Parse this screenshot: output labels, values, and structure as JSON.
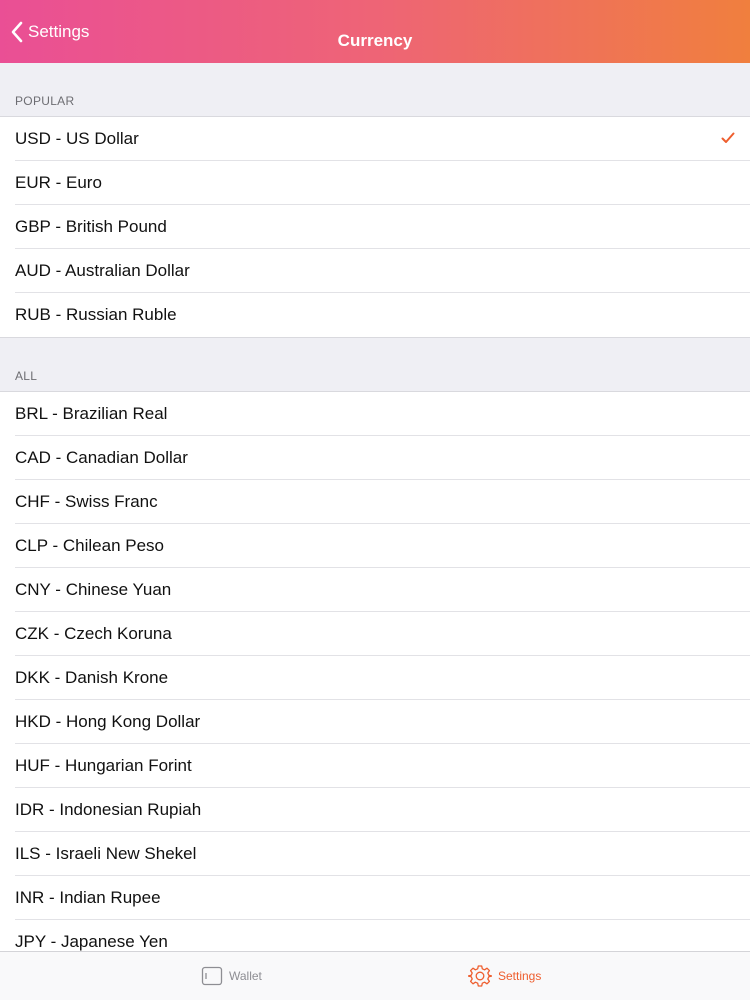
{
  "navbar": {
    "back_label": "Settings",
    "title": "Currency"
  },
  "sections": {
    "popular": {
      "header": "POPULAR",
      "items": [
        {
          "label": "USD - US Dollar",
          "selected": true
        },
        {
          "label": "EUR - Euro"
        },
        {
          "label": "GBP - British Pound"
        },
        {
          "label": "AUD - Australian Dollar"
        },
        {
          "label": "RUB - Russian Ruble"
        }
      ]
    },
    "all": {
      "header": "ALL",
      "items": [
        {
          "label": "BRL - Brazilian Real"
        },
        {
          "label": "CAD - Canadian Dollar"
        },
        {
          "label": "CHF - Swiss Franc"
        },
        {
          "label": "CLP - Chilean Peso"
        },
        {
          "label": "CNY - Chinese Yuan"
        },
        {
          "label": "CZK - Czech Koruna"
        },
        {
          "label": "DKK - Danish Krone"
        },
        {
          "label": "HKD - Hong Kong Dollar"
        },
        {
          "label": "HUF - Hungarian Forint"
        },
        {
          "label": "IDR - Indonesian Rupiah"
        },
        {
          "label": "ILS - Israeli New Shekel"
        },
        {
          "label": "INR - Indian Rupee"
        },
        {
          "label": "JPY - Japanese Yen"
        }
      ]
    }
  },
  "tabbar": {
    "wallet_label": "Wallet",
    "settings_label": "Settings"
  },
  "colors": {
    "accent": "#ee5e2e",
    "gradient_start": "#ea4f95",
    "gradient_end": "#f07f3e"
  },
  "icons": {
    "back": "chevron-left-icon",
    "selected": "checkmark-icon",
    "wallet": "wallet-icon",
    "settings": "gear-icon"
  }
}
